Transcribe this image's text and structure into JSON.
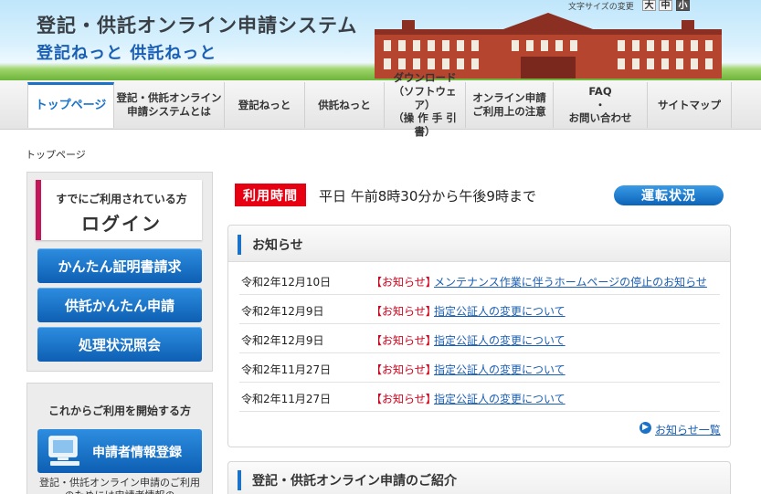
{
  "header": {
    "title": "登記・供託オンライン申請システム",
    "subtitle": "登記ねっと 供託ねっと",
    "font_size_label": "文字サイズの変更",
    "font_size_buttons": [
      "大",
      "中",
      "小"
    ]
  },
  "nav": {
    "items": [
      {
        "label": "トップページ",
        "active": true
      },
      {
        "label": "登記・供託オンライン\n申請システムとは"
      },
      {
        "label": "登記ねっと"
      },
      {
        "label": "供託ねっと"
      },
      {
        "label": "ダウンロード\n（ソフトウェア）\n（操 作 手 引 書）"
      },
      {
        "label": "オンライン申請\nご利用上の注意"
      },
      {
        "label": "FAQ\n・\nお問い合わせ"
      },
      {
        "label": "サイトマップ"
      }
    ]
  },
  "breadcrumb": "トップページ",
  "sidebar": {
    "login_small": "すでにご利用されている方",
    "login_big": "ログイン",
    "buttons": [
      "かんたん証明書請求",
      "供託かんたん申請",
      "処理状況照会"
    ],
    "start_title": "これからご利用を開始する方",
    "register_button": "申請者情報登録",
    "register_text": "登記・供託オンライン申請のご利用のためには申請者情報の"
  },
  "main": {
    "hours_tag": "利用時間",
    "hours_text": "平日 午前8時30分から午後9時まで",
    "status_button": "運転状況",
    "news_title": "お知らせ",
    "news": [
      {
        "date": "令和2年12月10日",
        "tag": "【お知らせ】",
        "text": "メンテナンス作業に伴うホームページの停止のお知らせ"
      },
      {
        "date": "令和2年12月9日",
        "tag": "【お知らせ】",
        "text": "指定公証人の変更について"
      },
      {
        "date": "令和2年12月9日",
        "tag": "【お知らせ】",
        "text": "指定公証人の変更について"
      },
      {
        "date": "令和2年11月27日",
        "tag": "【お知らせ】",
        "text": "指定公証人の変更について"
      },
      {
        "date": "令和2年11月27日",
        "tag": "【お知らせ】",
        "text": "指定公証人の変更について"
      }
    ],
    "more_link": "お知らせ一覧",
    "intro_title": "登記・供託オンライン申請のご紹介"
  },
  "colors": {
    "accent": "#1a73c9",
    "alert": "#e60012",
    "login_bar": "#c2185b"
  }
}
